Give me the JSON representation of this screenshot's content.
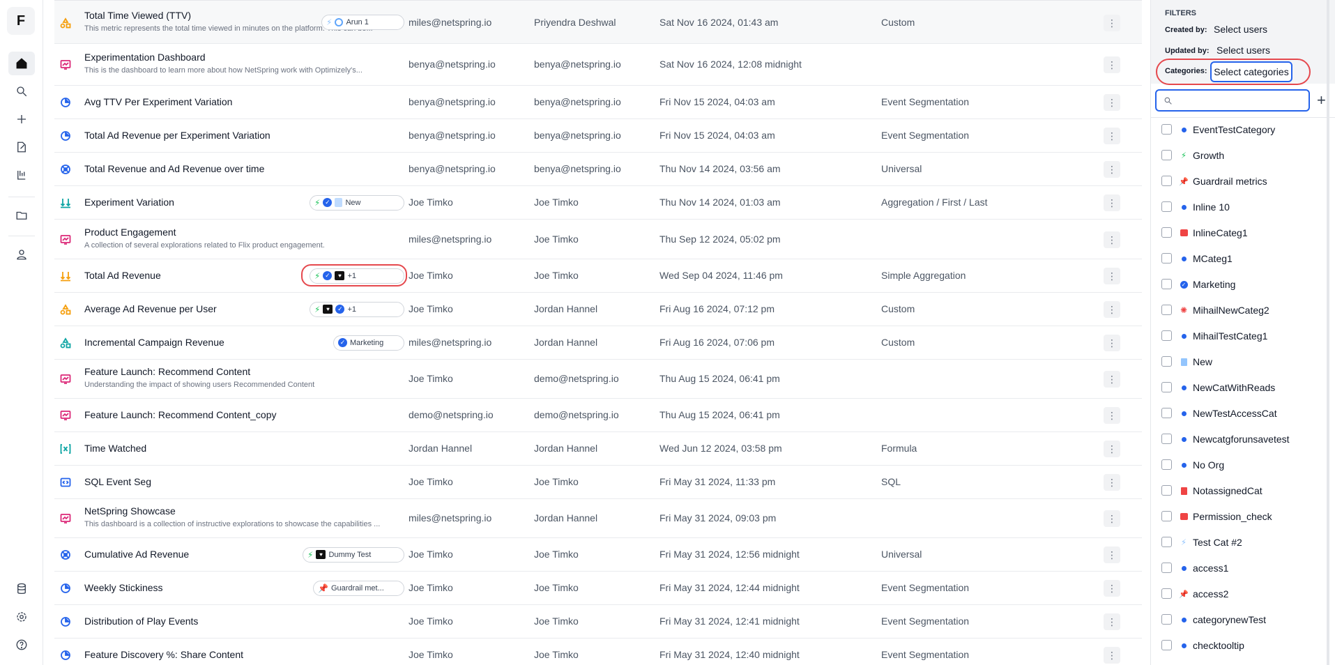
{
  "app": {
    "logo": "F"
  },
  "nav": [
    "home-icon",
    "search-icon",
    "plus-icon",
    "edit-icon",
    "flask-icon",
    "folder-icon",
    "person-icon",
    "database-icon",
    "gear-icon",
    "help-icon"
  ],
  "rows": [
    {
      "name": "Total Time Viewed (TTV)",
      "desc": "This metric represents the total time viewed in minutes on the platform. This can be...",
      "created": "miles@netspring.io",
      "updated": "Priyendra Deshwal",
      "date": "Sat Nov 16 2024, 01:43 am",
      "type": "Custom",
      "icon": "metric-custom-icon",
      "icolor": "#f59e0b",
      "chips": "Arun 1"
    },
    {
      "name": "Experimentation Dashboard",
      "desc": "This is the dashboard to learn more about how NetSpring work with Optimizely's...",
      "created": "benya@netspring.io",
      "updated": "benya@netspring.io",
      "date": "Sat Nov 16 2024, 12:08 midnight",
      "type": "",
      "icon": "dashboard-icon",
      "icolor": "#db2777"
    },
    {
      "name": "Avg TTV Per Experiment Variation",
      "desc": "",
      "created": "benya@netspring.io",
      "updated": "benya@netspring.io",
      "date": "Fri Nov 15 2024, 04:03 am",
      "type": "Event Segmentation",
      "icon": "segmentation-icon",
      "icolor": "#2563eb"
    },
    {
      "name": "Total Ad Revenue per Experiment Variation",
      "desc": "",
      "created": "benya@netspring.io",
      "updated": "benya@netspring.io",
      "date": "Fri Nov 15 2024, 04:03 am",
      "type": "Event Segmentation",
      "icon": "segmentation-icon",
      "icolor": "#2563eb"
    },
    {
      "name": "Total Revenue and Ad Revenue over time",
      "desc": "",
      "created": "benya@netspring.io",
      "updated": "benya@netspring.io",
      "date": "Thu Nov 14 2024, 03:56 am",
      "type": "Universal",
      "icon": "universal-icon",
      "icolor": "#2563eb"
    },
    {
      "name": "Experiment Variation",
      "desc": "",
      "created": "Joe Timko",
      "updated": "Joe Timko",
      "date": "Thu Nov 14 2024, 01:03 am",
      "type": "Aggregation / First / Last",
      "icon": "aggregation-icon",
      "icolor": "#0ea5a4",
      "chips": "New"
    },
    {
      "name": "Product Engagement",
      "desc": "A collection of several explorations related to Flix product engagement.",
      "created": "miles@netspring.io",
      "updated": "Joe Timko",
      "date": "Thu Sep 12 2024, 05:02 pm",
      "type": "",
      "icon": "dashboard-icon",
      "icolor": "#db2777"
    },
    {
      "name": "Total Ad Revenue",
      "desc": "",
      "created": "Joe Timko",
      "updated": "Joe Timko",
      "date": "Wed Sep 04 2024, 11:46 pm",
      "type": "Simple Aggregation",
      "icon": "aggregation-icon",
      "icolor": "#f59e0b",
      "chips": "+1"
    },
    {
      "name": "Average Ad Revenue per User",
      "desc": "",
      "created": "Joe Timko",
      "updated": "Jordan Hannel",
      "date": "Fri Aug 16 2024, 07:12 pm",
      "type": "Custom",
      "icon": "metric-custom-icon",
      "icolor": "#f59e0b",
      "chips": "+1"
    },
    {
      "name": "Incremental Campaign Revenue",
      "desc": "",
      "created": "miles@netspring.io",
      "updated": "Jordan Hannel",
      "date": "Fri Aug 16 2024, 07:06 pm",
      "type": "Custom",
      "icon": "metric-custom-icon",
      "icolor": "#0ea5a4",
      "chips": "Marketing"
    },
    {
      "name": "Feature Launch: Recommend Content",
      "desc": "Understanding the impact of showing users Recommended Content",
      "created": "Joe Timko",
      "updated": "demo@netspring.io",
      "date": "Thu Aug 15 2024, 06:41 pm",
      "type": "",
      "icon": "dashboard-icon",
      "icolor": "#db2777"
    },
    {
      "name": "Feature Launch: Recommend Content_copy",
      "desc": "",
      "created": "demo@netspring.io",
      "updated": "demo@netspring.io",
      "date": "Thu Aug 15 2024, 06:41 pm",
      "type": "",
      "icon": "dashboard-icon",
      "icolor": "#db2777"
    },
    {
      "name": "Time Watched",
      "desc": "",
      "created": "Jordan Hannel",
      "updated": "Jordan Hannel",
      "date": "Wed Jun 12 2024, 03:58 pm",
      "type": "Formula",
      "icon": "formula-icon",
      "icolor": "#0ea5a4"
    },
    {
      "name": "SQL Event Seg",
      "desc": "",
      "created": "Joe Timko",
      "updated": "Joe Timko",
      "date": "Fri May 31 2024, 11:33 pm",
      "type": "SQL",
      "icon": "sql-icon",
      "icolor": "#2563eb"
    },
    {
      "name": "NetSpring Showcase",
      "desc": "This dashboard is a collection of instructive explorations to showcase the capabilities ...",
      "created": "miles@netspring.io",
      "updated": "Jordan Hannel",
      "date": "Fri May 31 2024, 09:03 pm",
      "type": "",
      "icon": "dashboard-icon",
      "icolor": "#db2777"
    },
    {
      "name": "Cumulative Ad Revenue",
      "desc": "",
      "created": "Joe Timko",
      "updated": "Joe Timko",
      "date": "Fri May 31 2024, 12:56 midnight",
      "type": "Universal",
      "icon": "universal-icon",
      "icolor": "#2563eb",
      "chips": "Dummy Test"
    },
    {
      "name": "Weekly Stickiness",
      "desc": "",
      "created": "Joe Timko",
      "updated": "Joe Timko",
      "date": "Fri May 31 2024, 12:44 midnight",
      "type": "Event Segmentation",
      "icon": "segmentation-icon",
      "icolor": "#2563eb",
      "chips": "Guardrail met..."
    },
    {
      "name": "Distribution of Play Events",
      "desc": "",
      "created": "Joe Timko",
      "updated": "Joe Timko",
      "date": "Fri May 31 2024, 12:41 midnight",
      "type": "Event Segmentation",
      "icon": "segmentation-icon",
      "icolor": "#2563eb"
    },
    {
      "name": "Feature Discovery %: Share Content",
      "desc": "",
      "created": "Joe Timko",
      "updated": "Joe Timko",
      "date": "Fri May 31 2024, 12:40 midnight",
      "type": "Event Segmentation",
      "icon": "segmentation-icon",
      "icolor": "#2563eb"
    }
  ],
  "row_menu": "⋮",
  "filters": {
    "title": "FILTERS",
    "created_by_label": "Created by:",
    "created_by_value": "Select users",
    "updated_by_label": "Updated by:",
    "updated_by_value": "Select users",
    "categories_label": "Categories:",
    "categories_value": "Select categories",
    "add": "+",
    "options": [
      {
        "label": "EventTestCategory",
        "icon": "dot",
        "color": "#2563eb"
      },
      {
        "label": "Growth",
        "icon": "bolt",
        "color": "#22c55e"
      },
      {
        "label": "Guardrail metrics",
        "icon": "pin",
        "color": "#f59e0b"
      },
      {
        "label": "Inline 10",
        "icon": "dot",
        "color": "#2563eb"
      },
      {
        "label": "InlineCateg1",
        "icon": "chat",
        "color": "#ef4444"
      },
      {
        "label": "MCateg1",
        "icon": "dot",
        "color": "#2563eb"
      },
      {
        "label": "Marketing",
        "icon": "check",
        "color": "#2563eb"
      },
      {
        "label": "MihailNewCateg2",
        "icon": "sun",
        "color": "#ef4444"
      },
      {
        "label": "MihailTestCateg1",
        "icon": "dot",
        "color": "#2563eb"
      },
      {
        "label": "New",
        "icon": "doc",
        "color": "#93c5fd"
      },
      {
        "label": "NewCatWithReads",
        "icon": "dot",
        "color": "#2563eb"
      },
      {
        "label": "NewTestAccessCat",
        "icon": "dot",
        "color": "#2563eb"
      },
      {
        "label": "Newcatgforunsavetest",
        "icon": "dot",
        "color": "#2563eb"
      },
      {
        "label": "No Org",
        "icon": "dot",
        "color": "#2563eb"
      },
      {
        "label": "NotassignedCat",
        "icon": "doc",
        "color": "#ef4444"
      },
      {
        "label": "Permission_check",
        "icon": "chat",
        "color": "#ef4444"
      },
      {
        "label": "Test Cat #2",
        "icon": "bolt",
        "color": "#93c5fd"
      },
      {
        "label": "access1",
        "icon": "dot",
        "color": "#2563eb"
      },
      {
        "label": "access2",
        "icon": "pin",
        "color": "#ef4444"
      },
      {
        "label": "categorynewTest",
        "icon": "dot",
        "color": "#2563eb"
      },
      {
        "label": "checktooltip",
        "icon": "dot",
        "color": "#2563eb"
      }
    ]
  }
}
